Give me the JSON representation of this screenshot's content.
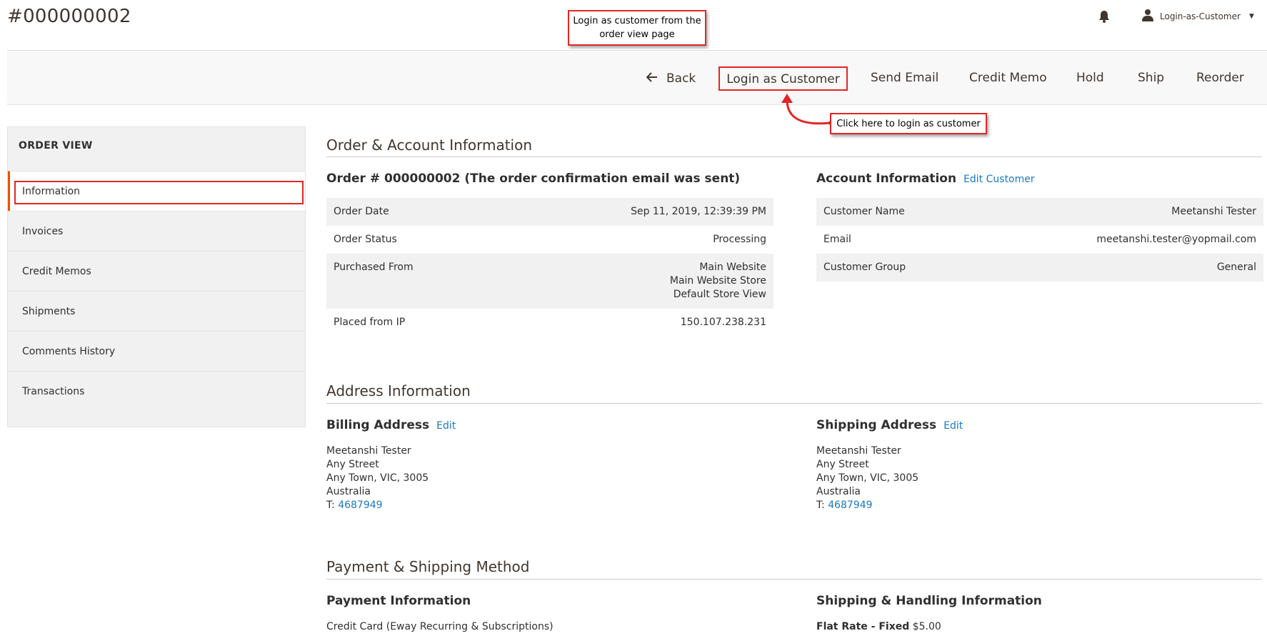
{
  "header": {
    "title": "#000000002",
    "bell_icon": "bell-icon",
    "user_icon": "user-icon",
    "user_name": "Login-as-Customer"
  },
  "callouts": {
    "top": "Login as customer from the order view page",
    "right": "Click here to login as customer"
  },
  "colors": {
    "accent_red": "#e22626",
    "link_blue": "#1979c3",
    "active_orange": "#eb5202"
  },
  "actions": {
    "back": "Back",
    "login_as_customer": "Login as Customer",
    "send_email": "Send Email",
    "credit_memo": "Credit Memo",
    "hold": "Hold",
    "ship": "Ship",
    "reorder": "Reorder"
  },
  "sidebar": {
    "title": "ORDER VIEW",
    "items": [
      {
        "label": "Information"
      },
      {
        "label": "Invoices"
      },
      {
        "label": "Credit Memos"
      },
      {
        "label": "Shipments"
      },
      {
        "label": "Comments History"
      },
      {
        "label": "Transactions"
      }
    ]
  },
  "order_account": {
    "section_title": "Order & Account Information",
    "order_title": "Order # 000000002 (The order confirmation email was sent)",
    "order_rows": [
      {
        "label": "Order Date",
        "value": "Sep 11, 2019, 12:39:39 PM"
      },
      {
        "label": "Order Status",
        "value": "Processing"
      },
      {
        "label": "Purchased From",
        "value_lines": [
          "Main Website",
          "Main Website Store",
          "Default Store View"
        ]
      },
      {
        "label": "Placed from IP",
        "value": "150.107.238.231"
      }
    ],
    "account_title": "Account Information",
    "edit_customer": "Edit Customer",
    "account_rows": [
      {
        "label": "Customer Name",
        "value": "Meetanshi Tester"
      },
      {
        "label": "Email",
        "value": "meetanshi.tester@yopmail.com"
      },
      {
        "label": "Customer Group",
        "value": "General"
      }
    ]
  },
  "address": {
    "section_title": "Address Information",
    "billing_title": "Billing Address",
    "shipping_title": "Shipping Address",
    "edit": "Edit",
    "name": "Meetanshi Tester",
    "street": "Any Street",
    "city": "Any Town, VIC, 3005",
    "country": "Australia",
    "phone_prefix": "T:",
    "phone": "4687949"
  },
  "payment_shipping": {
    "section_title": "Payment & Shipping Method",
    "payment_title": "Payment Information",
    "payment_method": "Credit Card (Eway Recurring & Subscriptions)",
    "shipping_title": "Shipping & Handling Information",
    "shipping_method": "Flat Rate - Fixed",
    "shipping_price": "$5.00"
  }
}
